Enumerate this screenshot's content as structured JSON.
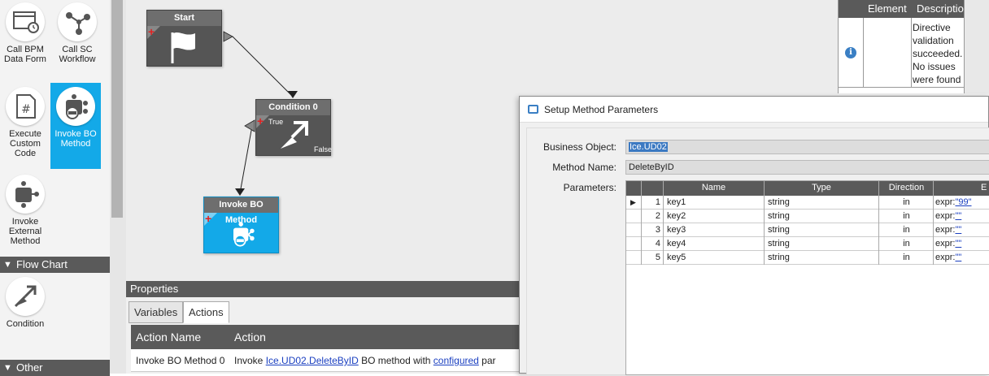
{
  "palette": {
    "tools": [
      {
        "label": "Call BPM Data Form",
        "icon": "form-window-icon"
      },
      {
        "label": "Call SC Workflow",
        "icon": "workflow-nodes-icon"
      },
      {
        "label": "Execute Custom Code",
        "icon": "hash-document-icon"
      },
      {
        "label": "Invoke BO Method",
        "icon": "bo-method-icon"
      },
      {
        "label": "Invoke External Method",
        "icon": "external-method-icon"
      },
      {
        "label": "Condition",
        "icon": "condition-arrows-icon"
      }
    ],
    "selected_tool": "Invoke BO Method",
    "sections": {
      "flow_chart": "Flow Chart",
      "other": "Other"
    }
  },
  "canvas": {
    "nodes": {
      "start": {
        "title": "Start"
      },
      "condition": {
        "title": "Condition 0",
        "true_label": "True",
        "false_label": "False"
      },
      "invoke": {
        "title": "Invoke BO Method"
      }
    }
  },
  "results": {
    "col_element": "Element",
    "col_description": "Descriptio",
    "message": "Directive validation succeeded. No issues were found"
  },
  "properties": {
    "title": "Properties",
    "tabs": [
      "Variables",
      "Actions"
    ],
    "active_tab": "Actions",
    "table_headers": [
      "Action Name",
      "Action"
    ],
    "row": {
      "action_name": "Invoke BO Method 0",
      "action_prefix": "Invoke ",
      "action_link": "Ice.UD02.DeleteByID",
      "action_mid": " BO method with ",
      "action_link2": "configured",
      "action_suffix": " par"
    }
  },
  "dialog": {
    "title": "Setup Method Parameters",
    "business_object_label": "Business Object:",
    "business_object_value": "Ice.UD02",
    "method_name_label": "Method Name:",
    "method_name_value": "DeleteByID",
    "parameters_label": "Parameters:",
    "grid_headers": {
      "name": "Name",
      "type": "Type",
      "direction": "Direction",
      "e": "E"
    },
    "rows": [
      {
        "num": "1",
        "name": "key1",
        "type": "string",
        "dir": "in",
        "expr_prefix": "expr:",
        "expr_value": "\"99\""
      },
      {
        "num": "2",
        "name": "key2",
        "type": "string",
        "dir": "in",
        "expr_prefix": "expr:",
        "expr_value": "\"\""
      },
      {
        "num": "3",
        "name": "key3",
        "type": "string",
        "dir": "in",
        "expr_prefix": "expr:",
        "expr_value": "\"\""
      },
      {
        "num": "4",
        "name": "key4",
        "type": "string",
        "dir": "in",
        "expr_prefix": "expr:",
        "expr_value": "\"\""
      },
      {
        "num": "5",
        "name": "key5",
        "type": "string",
        "dir": "in",
        "expr_prefix": "expr:",
        "expr_value": "\"\""
      }
    ],
    "current_row_marker": "▶"
  },
  "colors": {
    "accent": "#13a9e8",
    "header_gray": "#5a5a5a",
    "link": "#1a3fc0",
    "selection": "#3b79c2"
  }
}
